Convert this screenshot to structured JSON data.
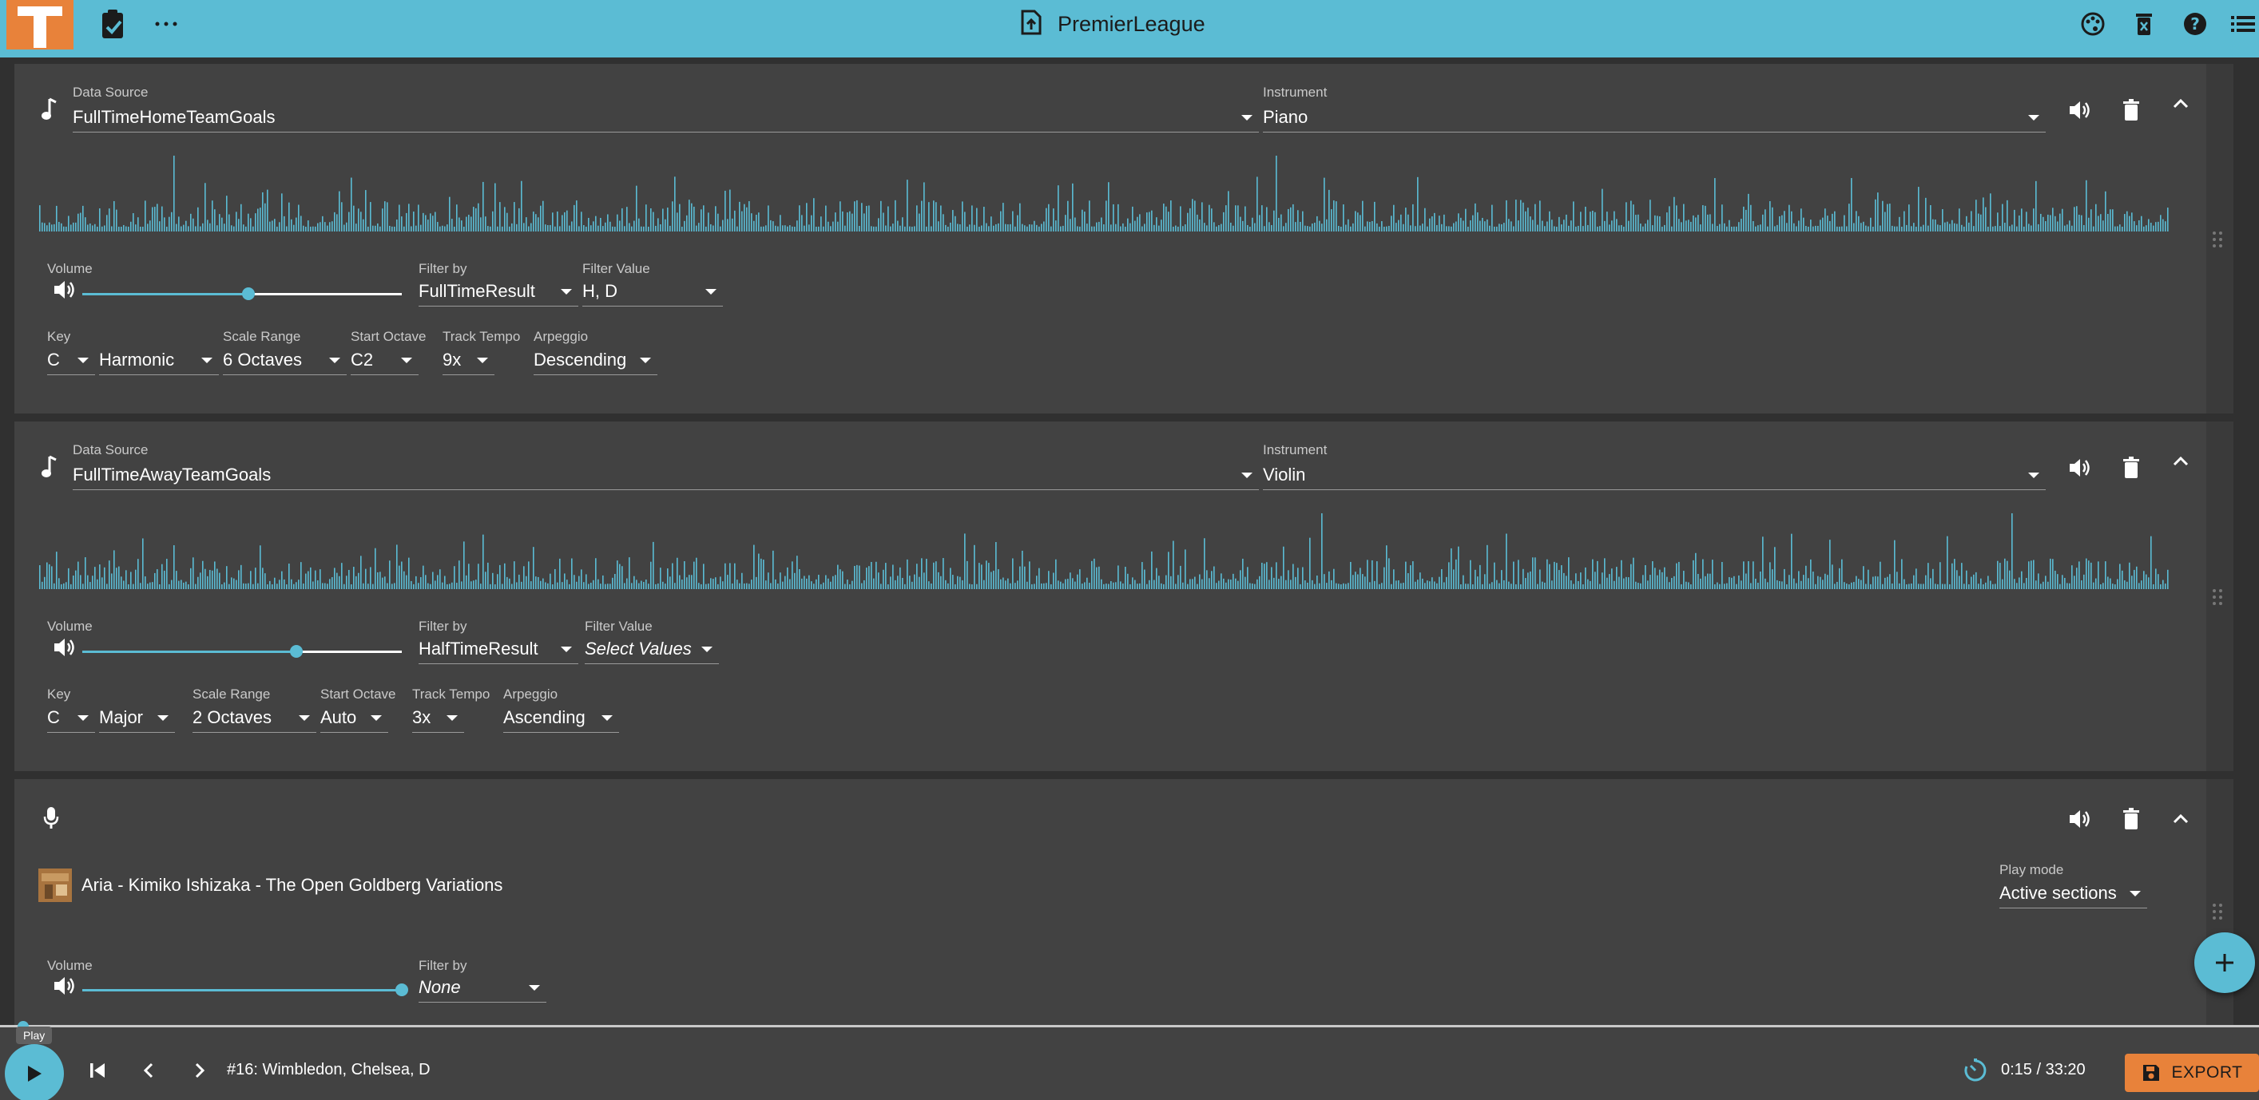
{
  "header": {
    "title": "PremierLeague",
    "icons": [
      "clipboard-check-icon",
      "more-horizontal-icon",
      "file-upload-icon",
      "palette-icon",
      "clear-all-icon",
      "help-icon",
      "list-icon"
    ]
  },
  "tracks": [
    {
      "data_source_label": "Data Source",
      "data_source": "FullTimeHomeTeamGoals",
      "instrument_label": "Instrument",
      "instrument": "Piano",
      "volume_label": "Volume",
      "volume": 0.52,
      "filter_by_label": "Filter by",
      "filter_by": "FullTimeResult",
      "filter_value_label": "Filter Value",
      "filter_value": "H, D",
      "key_label": "Key",
      "key": "C",
      "scale": "Harmonic",
      "scale_range_label": "Scale Range",
      "scale_range": "6 Octaves",
      "start_octave_label": "Start Octave",
      "start_octave": "C2",
      "track_tempo_label": "Track Tempo",
      "track_tempo": "9x",
      "arpeggio_label": "Arpeggio",
      "arpeggio": "Descending"
    },
    {
      "data_source_label": "Data Source",
      "data_source": "FullTimeAwayTeamGoals",
      "instrument_label": "Instrument",
      "instrument": "Violin",
      "volume_label": "Volume",
      "volume": 0.67,
      "filter_by_label": "Filter by",
      "filter_by": "HalfTimeResult",
      "filter_value_label": "Filter Value",
      "filter_value": "Select Values",
      "key_label": "Key",
      "key": "C",
      "scale": "Major",
      "scale_range_label": "Scale Range",
      "scale_range": "2 Octaves",
      "start_octave_label": "Start Octave",
      "start_octave": "Auto",
      "track_tempo_label": "Track Tempo",
      "track_tempo": "3x",
      "arpeggio_label": "Arpeggio",
      "arpeggio": "Ascending"
    }
  ],
  "audio_track": {
    "song_title": "Aria - Kimiko Ishizaka - The Open Goldberg Variations",
    "play_mode_label": "Play mode",
    "play_mode": "Active sections",
    "volume_label": "Volume",
    "volume": 1.0,
    "filter_by_label": "Filter by",
    "filter_by": "None"
  },
  "player": {
    "tooltip": "Play",
    "now_playing": "#16: Wimbledon, Chelsea, D",
    "time": "0:15 / 33:20",
    "export_label": "EXPORT",
    "progress": 0.0075
  },
  "colors": {
    "accent": "#5bbcd4",
    "export": "#e8823a",
    "panel": "#424242",
    "background": "#303030"
  }
}
